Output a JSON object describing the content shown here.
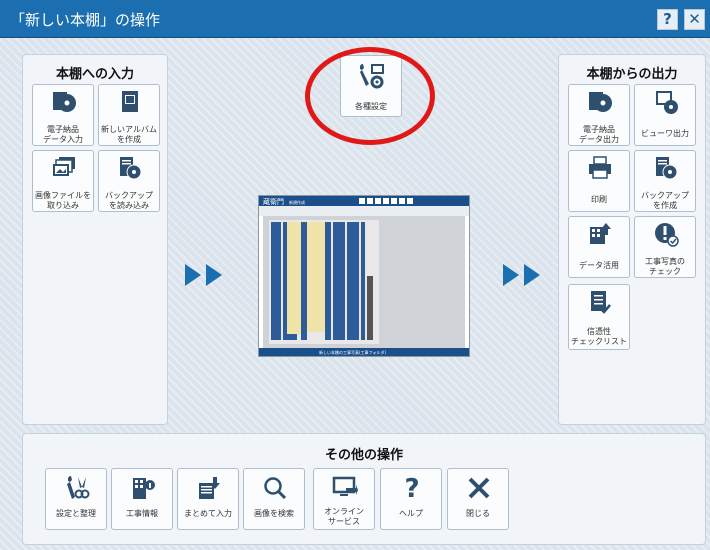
{
  "window": {
    "title": "「新しい本棚」の操作",
    "help_label": "?",
    "close_label": "✕"
  },
  "left_panel": {
    "title": "本棚への入力",
    "buttons": [
      {
        "label": "電子納品\nデータ入力",
        "icon": "disc-import-icon"
      },
      {
        "label": "新しいアルバム\nを作成",
        "icon": "album-icon"
      },
      {
        "label": "画像ファイルを\n取り込み",
        "icon": "image-files-icon"
      },
      {
        "label": "バックアップ\nを読み込み",
        "icon": "backup-load-icon"
      }
    ]
  },
  "center": {
    "settings_label": "各種設定",
    "preview": {
      "logo": "蔵衛門",
      "subtitle": "新規作成",
      "footer": "新しい本棚の工事写真(工事フォルダ)"
    }
  },
  "right_panel": {
    "title": "本棚からの出力",
    "buttons": [
      {
        "label": "電子納品\nデータ出力",
        "icon": "disc-export-icon"
      },
      {
        "label": "ビューワ出力",
        "icon": "viewer-export-icon"
      },
      {
        "label": "印刷",
        "icon": "printer-icon"
      },
      {
        "label": "バックアップ\nを作成",
        "icon": "backup-create-icon"
      },
      {
        "label": "データ活用",
        "icon": "data-use-icon"
      },
      {
        "label": "工事写真の\nチェック",
        "icon": "photo-check-icon"
      },
      {
        "label": "信憑性\nチェックリスト",
        "icon": "checklist-icon"
      }
    ]
  },
  "bottom_panel": {
    "title": "その他の操作",
    "buttons": [
      {
        "label": "設定と整理",
        "icon": "tools-icon"
      },
      {
        "label": "工事情報",
        "icon": "building-info-icon"
      },
      {
        "label": "まとめて入力",
        "icon": "batch-input-icon"
      },
      {
        "label": "画像を検索",
        "icon": "search-icon"
      },
      {
        "label": "オンライン\nサービス",
        "icon": "online-service-icon"
      },
      {
        "label": "ヘルプ",
        "icon": "help-icon"
      },
      {
        "label": "閉じる",
        "icon": "close-icon"
      }
    ]
  },
  "colors": {
    "titlebar": "#1b6fb0",
    "icon": "#2f4f6f",
    "highlight_circle": "#e01818"
  }
}
